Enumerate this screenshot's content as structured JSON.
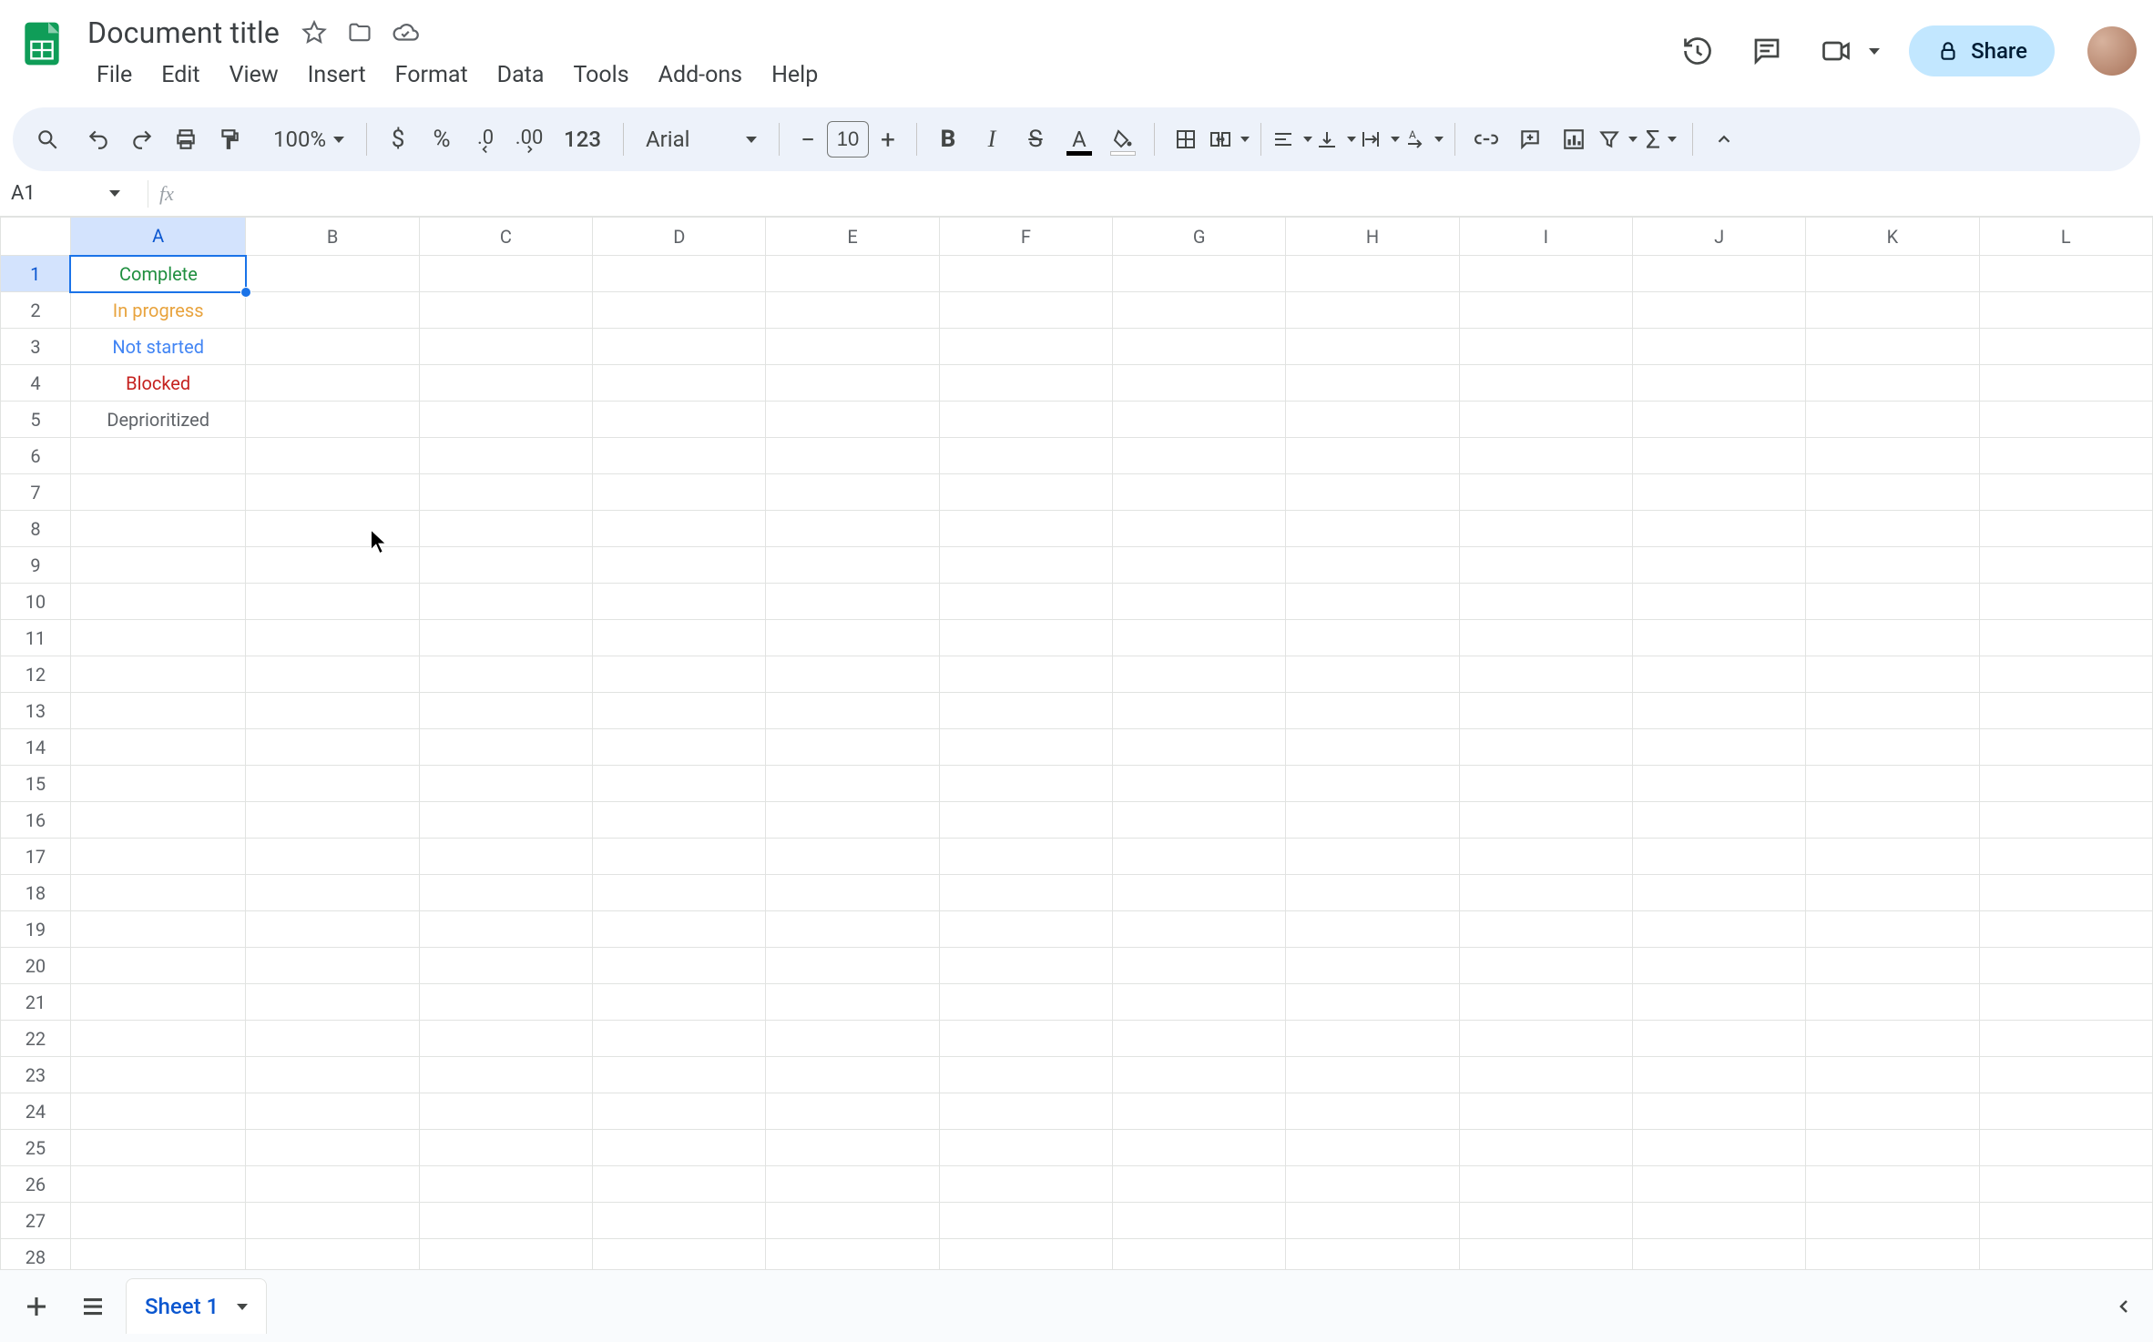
{
  "header": {
    "doc_title": "Document title",
    "menus": [
      "File",
      "Edit",
      "View",
      "Insert",
      "Format",
      "Data",
      "Tools",
      "Add-ons",
      "Help"
    ],
    "share_label": "Share"
  },
  "toolbar": {
    "zoom": "100%",
    "font_name": "Arial",
    "font_size": "10",
    "numfmt_label": "123"
  },
  "namebox": {
    "ref": "A1",
    "formula": ""
  },
  "grid": {
    "columns": [
      "A",
      "B",
      "C",
      "D",
      "E",
      "F",
      "G",
      "H",
      "I",
      "J",
      "K",
      "L"
    ],
    "row_count": 29,
    "selected": {
      "row": 1,
      "col": "A"
    },
    "cells": [
      {
        "row": 1,
        "col": "A",
        "text": "Complete",
        "color_class": "c-green",
        "selected": true
      },
      {
        "row": 2,
        "col": "A",
        "text": "In progress",
        "color_class": "c-yellow"
      },
      {
        "row": 3,
        "col": "A",
        "text": "Not started",
        "color_class": "c-blue"
      },
      {
        "row": 4,
        "col": "A",
        "text": "Blocked",
        "color_class": "c-red"
      },
      {
        "row": 5,
        "col": "A",
        "text": "Deprioritized",
        "color_class": "c-gray"
      }
    ]
  },
  "sheets": {
    "active_name": "Sheet 1"
  }
}
